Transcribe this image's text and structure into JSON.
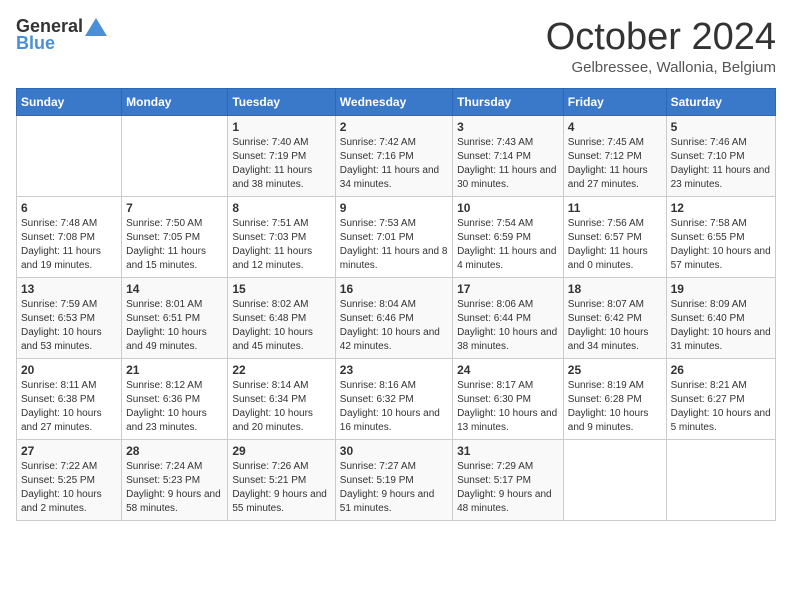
{
  "header": {
    "logo_general": "General",
    "logo_blue": "Blue",
    "month_title": "October 2024",
    "location": "Gelbressee, Wallonia, Belgium"
  },
  "weekdays": [
    "Sunday",
    "Monday",
    "Tuesday",
    "Wednesday",
    "Thursday",
    "Friday",
    "Saturday"
  ],
  "weeks": [
    [
      {
        "day": "",
        "sunrise": "",
        "sunset": "",
        "daylight": ""
      },
      {
        "day": "",
        "sunrise": "",
        "sunset": "",
        "daylight": ""
      },
      {
        "day": "1",
        "sunrise": "Sunrise: 7:40 AM",
        "sunset": "Sunset: 7:19 PM",
        "daylight": "Daylight: 11 hours and 38 minutes."
      },
      {
        "day": "2",
        "sunrise": "Sunrise: 7:42 AM",
        "sunset": "Sunset: 7:16 PM",
        "daylight": "Daylight: 11 hours and 34 minutes."
      },
      {
        "day": "3",
        "sunrise": "Sunrise: 7:43 AM",
        "sunset": "Sunset: 7:14 PM",
        "daylight": "Daylight: 11 hours and 30 minutes."
      },
      {
        "day": "4",
        "sunrise": "Sunrise: 7:45 AM",
        "sunset": "Sunset: 7:12 PM",
        "daylight": "Daylight: 11 hours and 27 minutes."
      },
      {
        "day": "5",
        "sunrise": "Sunrise: 7:46 AM",
        "sunset": "Sunset: 7:10 PM",
        "daylight": "Daylight: 11 hours and 23 minutes."
      }
    ],
    [
      {
        "day": "6",
        "sunrise": "Sunrise: 7:48 AM",
        "sunset": "Sunset: 7:08 PM",
        "daylight": "Daylight: 11 hours and 19 minutes."
      },
      {
        "day": "7",
        "sunrise": "Sunrise: 7:50 AM",
        "sunset": "Sunset: 7:05 PM",
        "daylight": "Daylight: 11 hours and 15 minutes."
      },
      {
        "day": "8",
        "sunrise": "Sunrise: 7:51 AM",
        "sunset": "Sunset: 7:03 PM",
        "daylight": "Daylight: 11 hours and 12 minutes."
      },
      {
        "day": "9",
        "sunrise": "Sunrise: 7:53 AM",
        "sunset": "Sunset: 7:01 PM",
        "daylight": "Daylight: 11 hours and 8 minutes."
      },
      {
        "day": "10",
        "sunrise": "Sunrise: 7:54 AM",
        "sunset": "Sunset: 6:59 PM",
        "daylight": "Daylight: 11 hours and 4 minutes."
      },
      {
        "day": "11",
        "sunrise": "Sunrise: 7:56 AM",
        "sunset": "Sunset: 6:57 PM",
        "daylight": "Daylight: 11 hours and 0 minutes."
      },
      {
        "day": "12",
        "sunrise": "Sunrise: 7:58 AM",
        "sunset": "Sunset: 6:55 PM",
        "daylight": "Daylight: 10 hours and 57 minutes."
      }
    ],
    [
      {
        "day": "13",
        "sunrise": "Sunrise: 7:59 AM",
        "sunset": "Sunset: 6:53 PM",
        "daylight": "Daylight: 10 hours and 53 minutes."
      },
      {
        "day": "14",
        "sunrise": "Sunrise: 8:01 AM",
        "sunset": "Sunset: 6:51 PM",
        "daylight": "Daylight: 10 hours and 49 minutes."
      },
      {
        "day": "15",
        "sunrise": "Sunrise: 8:02 AM",
        "sunset": "Sunset: 6:48 PM",
        "daylight": "Daylight: 10 hours and 45 minutes."
      },
      {
        "day": "16",
        "sunrise": "Sunrise: 8:04 AM",
        "sunset": "Sunset: 6:46 PM",
        "daylight": "Daylight: 10 hours and 42 minutes."
      },
      {
        "day": "17",
        "sunrise": "Sunrise: 8:06 AM",
        "sunset": "Sunset: 6:44 PM",
        "daylight": "Daylight: 10 hours and 38 minutes."
      },
      {
        "day": "18",
        "sunrise": "Sunrise: 8:07 AM",
        "sunset": "Sunset: 6:42 PM",
        "daylight": "Daylight: 10 hours and 34 minutes."
      },
      {
        "day": "19",
        "sunrise": "Sunrise: 8:09 AM",
        "sunset": "Sunset: 6:40 PM",
        "daylight": "Daylight: 10 hours and 31 minutes."
      }
    ],
    [
      {
        "day": "20",
        "sunrise": "Sunrise: 8:11 AM",
        "sunset": "Sunset: 6:38 PM",
        "daylight": "Daylight: 10 hours and 27 minutes."
      },
      {
        "day": "21",
        "sunrise": "Sunrise: 8:12 AM",
        "sunset": "Sunset: 6:36 PM",
        "daylight": "Daylight: 10 hours and 23 minutes."
      },
      {
        "day": "22",
        "sunrise": "Sunrise: 8:14 AM",
        "sunset": "Sunset: 6:34 PM",
        "daylight": "Daylight: 10 hours and 20 minutes."
      },
      {
        "day": "23",
        "sunrise": "Sunrise: 8:16 AM",
        "sunset": "Sunset: 6:32 PM",
        "daylight": "Daylight: 10 hours and 16 minutes."
      },
      {
        "day": "24",
        "sunrise": "Sunrise: 8:17 AM",
        "sunset": "Sunset: 6:30 PM",
        "daylight": "Daylight: 10 hours and 13 minutes."
      },
      {
        "day": "25",
        "sunrise": "Sunrise: 8:19 AM",
        "sunset": "Sunset: 6:28 PM",
        "daylight": "Daylight: 10 hours and 9 minutes."
      },
      {
        "day": "26",
        "sunrise": "Sunrise: 8:21 AM",
        "sunset": "Sunset: 6:27 PM",
        "daylight": "Daylight: 10 hours and 5 minutes."
      }
    ],
    [
      {
        "day": "27",
        "sunrise": "Sunrise: 7:22 AM",
        "sunset": "Sunset: 5:25 PM",
        "daylight": "Daylight: 10 hours and 2 minutes."
      },
      {
        "day": "28",
        "sunrise": "Sunrise: 7:24 AM",
        "sunset": "Sunset: 5:23 PM",
        "daylight": "Daylight: 9 hours and 58 minutes."
      },
      {
        "day": "29",
        "sunrise": "Sunrise: 7:26 AM",
        "sunset": "Sunset: 5:21 PM",
        "daylight": "Daylight: 9 hours and 55 minutes."
      },
      {
        "day": "30",
        "sunrise": "Sunrise: 7:27 AM",
        "sunset": "Sunset: 5:19 PM",
        "daylight": "Daylight: 9 hours and 51 minutes."
      },
      {
        "day": "31",
        "sunrise": "Sunrise: 7:29 AM",
        "sunset": "Sunset: 5:17 PM",
        "daylight": "Daylight: 9 hours and 48 minutes."
      },
      {
        "day": "",
        "sunrise": "",
        "sunset": "",
        "daylight": ""
      },
      {
        "day": "",
        "sunrise": "",
        "sunset": "",
        "daylight": ""
      }
    ]
  ]
}
